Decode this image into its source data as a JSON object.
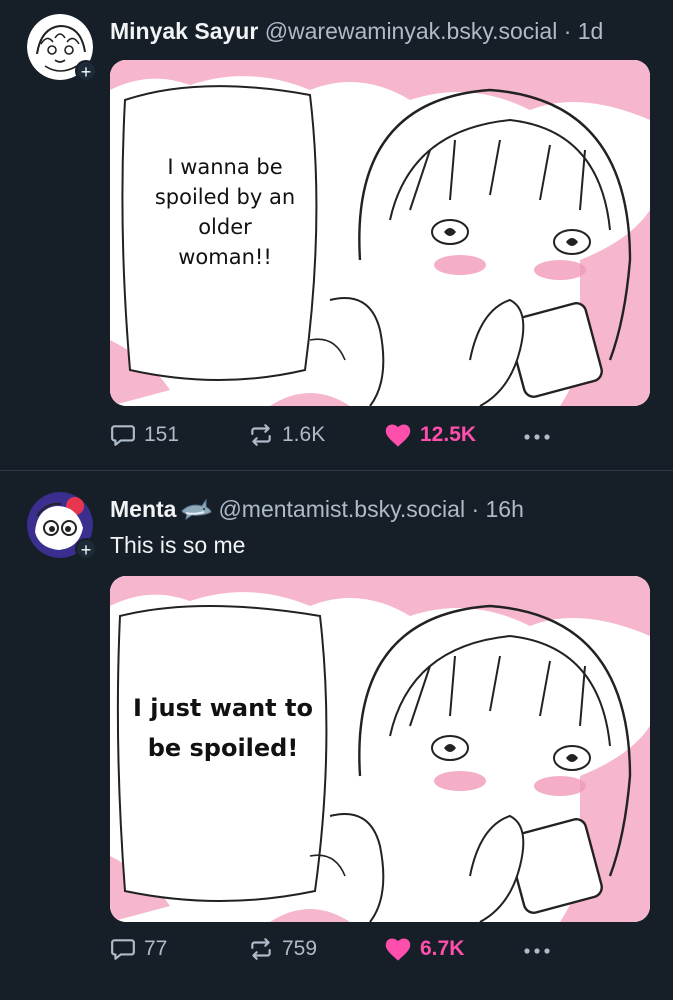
{
  "posts": [
    {
      "author_name": "Minyak Sayur",
      "handle": "@warewaminyak.bsky.social",
      "separator": "·",
      "time": "1d",
      "badge": "",
      "text": "",
      "image_caption": "I wanna be spoiled by an older woman!!",
      "follow_icon": "plus-icon",
      "stats": {
        "replies": "151",
        "reposts": "1.6K",
        "likes": "12.5K"
      },
      "liked": true
    },
    {
      "author_name": "Menta",
      "handle": "@mentamist.bsky.social",
      "separator": "·",
      "time": "16h",
      "badge": "shark-emoji",
      "text": "This is so me",
      "image_caption": "I just want to be spoiled!",
      "follow_icon": "plus-icon",
      "stats": {
        "replies": "77",
        "reposts": "759",
        "likes": "6.7K"
      },
      "liked": true
    }
  ],
  "colors": {
    "background": "#161e27",
    "text": "#f1f3f5",
    "muted": "#aebbc9",
    "like": "#ff4fad",
    "divider": "#2e3a48"
  },
  "icons": {
    "reply": "speech-bubble-icon",
    "repost": "repost-arrows-icon",
    "like": "heart-icon",
    "more": "ellipsis-icon"
  }
}
